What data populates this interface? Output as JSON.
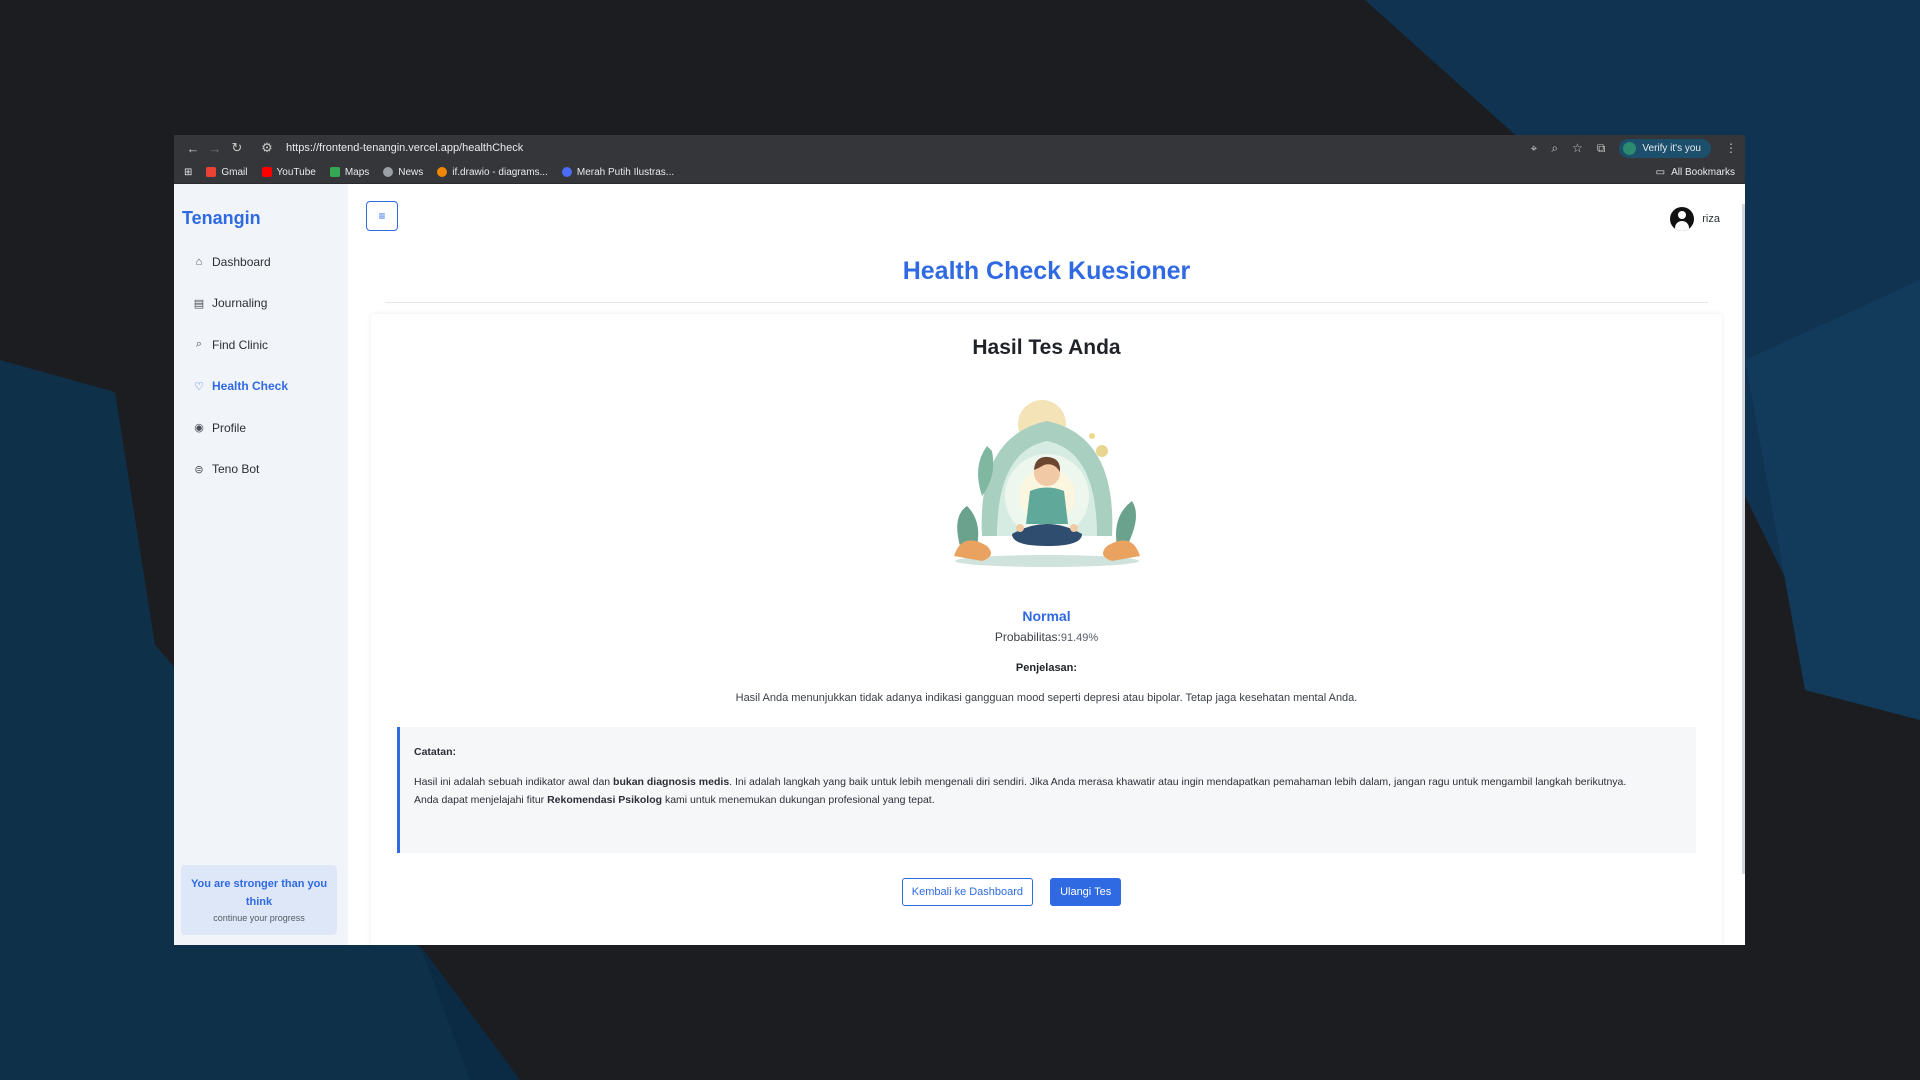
{
  "browser": {
    "url": "https://frontend-tenangin.vercel.app/healthCheck",
    "verify_label": "Verify it's you",
    "bookmarks": [
      {
        "label": "Gmail",
        "color": "#ea4335"
      },
      {
        "label": "YouTube",
        "color": "#ff0000"
      },
      {
        "label": "Maps",
        "color": "#34a853"
      },
      {
        "label": "News",
        "color": "#9aa0a6"
      },
      {
        "label": "if.drawio - diagrams...",
        "color": "#f08705"
      },
      {
        "label": "Merah Putih Ilustras...",
        "color": "#4a6cf7"
      }
    ],
    "all_bookmarks": "All Bookmarks"
  },
  "sidebar": {
    "brand": "Tenangin",
    "items": [
      {
        "label": "Dashboard",
        "icon": "home-icon"
      },
      {
        "label": "Journaling",
        "icon": "journal-icon"
      },
      {
        "label": "Find Clinic",
        "icon": "search-icon"
      },
      {
        "label": "Health Check",
        "icon": "heart-icon"
      },
      {
        "label": "Profile",
        "icon": "user-circle-icon"
      },
      {
        "label": "Teno Bot",
        "icon": "bot-icon"
      }
    ],
    "active": "Health Check",
    "promo_title": "You are stronger than you think",
    "promo_subtitle": "continue your progress"
  },
  "header": {
    "menu_icon": "≡",
    "username": "riza"
  },
  "page": {
    "title": "Health Check Kuesioner",
    "card_title": "Hasil Tes Anda",
    "result_label": "Normal",
    "probability_label": "Probabilitas:",
    "probability_value": "91.49%",
    "explanation_label": "Penjelasan:",
    "explanation_text": "Hasil Anda menunjukkan tidak adanya indikasi gangguan mood seperti depresi atau bipolar. Tetap jaga kesehatan mental Anda.",
    "note": {
      "title": "Catatan:",
      "line1_pre": "Hasil ini adalah sebuah indikator awal dan ",
      "line1_bold": "bukan diagnosis medis",
      "line1_post": ". Ini adalah langkah yang baik untuk lebih mengenali diri sendiri. Jika Anda merasa khawatir atau ingin mendapatkan pemahaman lebih dalam, jangan ragu untuk mengambil langkah berikutnya.",
      "line2_pre": "Anda dapat menjelajahi fitur ",
      "line2_bold": "Rekomendasi Psikolog",
      "line2_post": " kami untuk menemukan dukungan profesional yang tepat."
    },
    "back_button": "Kembali ke Dashboard",
    "retry_button": "Ulangi Tes"
  },
  "colors": {
    "accent": "#2f6ae3",
    "sidebar_bg": "#f1f4f9",
    "desktop_bg": "#1c1d20",
    "desktop_shape": "#0f3350"
  }
}
